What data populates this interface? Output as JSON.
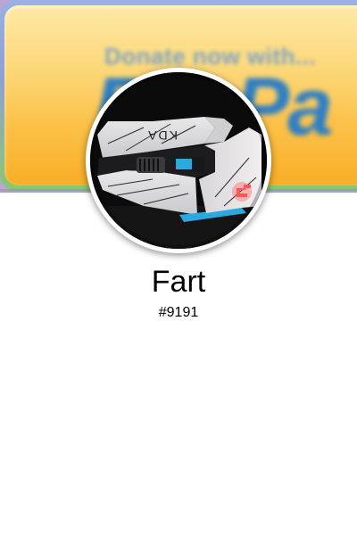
{
  "banner": {
    "line1": "Donate now with...",
    "line2": "PayPa"
  },
  "profile": {
    "username": "Fart",
    "discriminator": "#9191",
    "avatar_icon": "gaming-mouse-photo"
  },
  "colors": {
    "banner_gold": "#fbc24a",
    "banner_text_blue": "#2f7fc4",
    "mouse_accent_blue": "#2aa8e0",
    "logo_red": "#ff4a4a"
  }
}
